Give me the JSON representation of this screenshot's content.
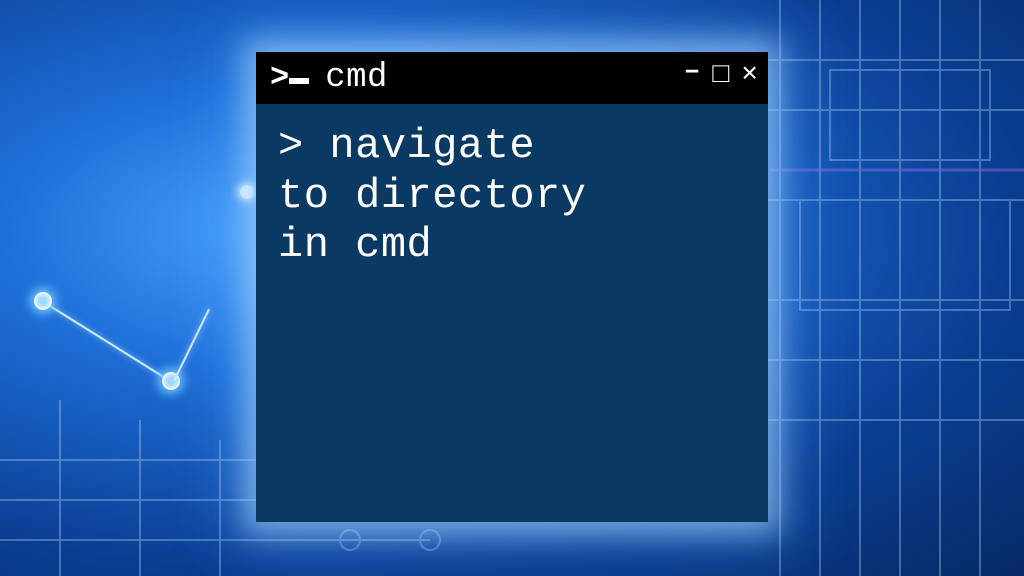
{
  "window": {
    "title": "cmd",
    "prompt_glyph": ">",
    "controls": {
      "minimize": "–",
      "maximize": "□",
      "close": "×"
    }
  },
  "terminal": {
    "prompt": ">",
    "lines": [
      "> navigate",
      "to directory",
      "in cmd"
    ]
  },
  "colors": {
    "titlebar_bg": "#000000",
    "terminal_bg": "#0a3a63",
    "text": "#ffffff",
    "bg_glow": "#4da6ff"
  }
}
